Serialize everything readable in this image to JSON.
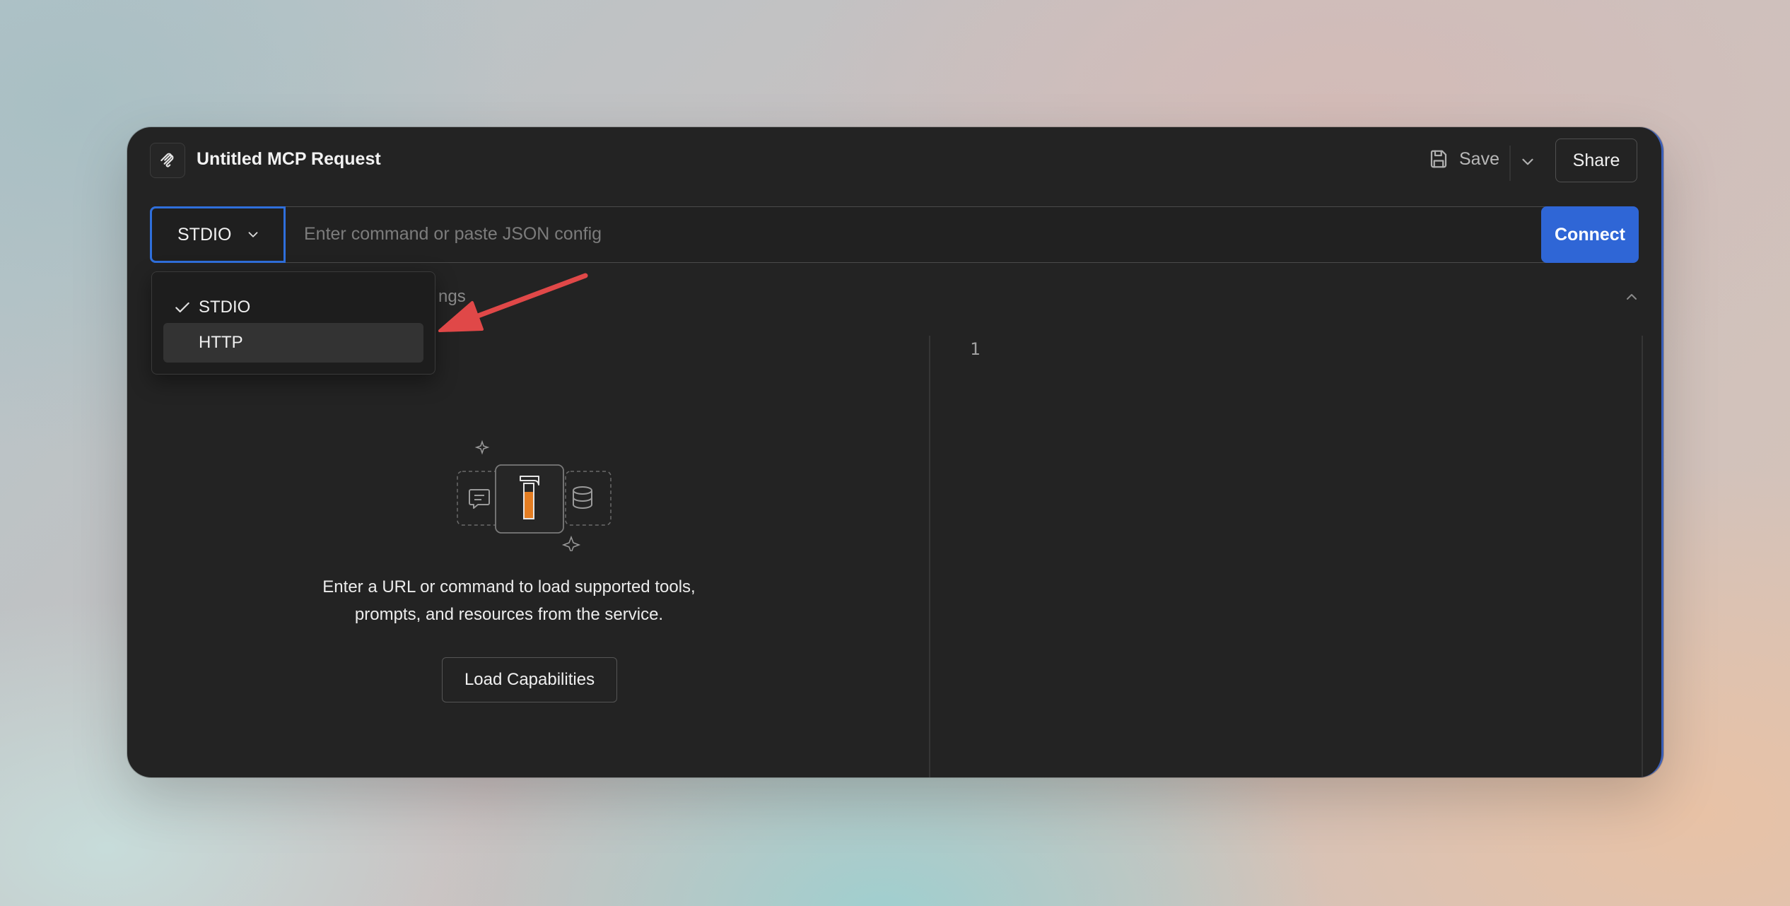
{
  "header": {
    "title": "Untitled MCP Request",
    "save_label": "Save",
    "share_label": "Share"
  },
  "request_bar": {
    "transport_selected": "STDIO",
    "input_value": "",
    "input_placeholder": "Enter command or paste JSON config",
    "connect_label": "Connect"
  },
  "transport_menu": {
    "options": [
      {
        "label": "STDIO",
        "checked": true
      },
      {
        "label": "HTTP",
        "checked": false
      }
    ]
  },
  "settings_section": {
    "label_visible_fragment": "ngs"
  },
  "empty_state": {
    "message_line1": "Enter a URL or command to load supported tools,",
    "message_line2": "prompts, and resources from the service.",
    "button_label": "Load Capabilities"
  },
  "editor": {
    "line_numbers": [
      "1"
    ]
  },
  "colors": {
    "accent": "#2f66d6",
    "window_bg": "#232323",
    "annotation_arrow": "#e04848"
  }
}
